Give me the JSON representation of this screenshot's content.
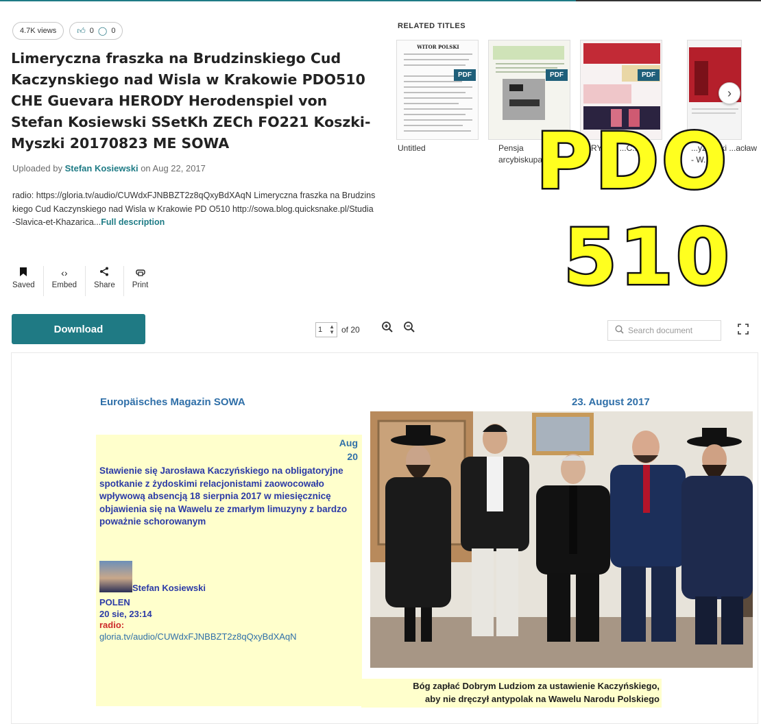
{
  "stats": {
    "views": "4.7K views",
    "likes": "0",
    "comments": "0"
  },
  "title": "Limeryczna fraszka na Brudzinskiego Cud Kaczynskiego nad Wisla w Krakowie PDO510 CHE Guevara HERODY Herodenspiel von Stefan Kosiewski SSetKh ZECh FO221 Koszki-Myszki 20170823 ME SOWA",
  "upload": {
    "prefix": "Uploaded by",
    "author": "Stefan Kosiewski",
    "date_text": "on Aug 22, 2017"
  },
  "description": {
    "text": "radio: https://gloria.tv/audio/CUWdxFJNBBZT2z8qQxyBdXAqN Limeryczna fraszka na Brudzinskiego Cud Kaczynskiego nad Wisla w Krakowie PD O510 http://sowa.blog.quicksnake.pl/Studia-Slavica-et-Khazarica...",
    "more_link": "Full description"
  },
  "actions": [
    {
      "label": "Saved",
      "icon": "bookmark-icon"
    },
    {
      "label": "Embed",
      "icon": "code-icon"
    },
    {
      "label": "Share",
      "icon": "share-icon"
    },
    {
      "label": "Print",
      "icon": "print-icon"
    }
  ],
  "download_label": "Download",
  "viewer": {
    "page": "1",
    "of_pages": "of 20",
    "search_placeholder": "Search document"
  },
  "related": {
    "heading": "RELATED TITLES",
    "pdf_badge": "PDF",
    "items": [
      {
        "label": "Untitled"
      },
      {
        "label": "Pensja arcybiskupa"
      },
      {
        "label": "...RYSTA ...C...SKI"
      },
      {
        "label": "...yżewski ...acław - W..."
      }
    ]
  },
  "overlay": {
    "line1": "PDO",
    "line2": "510"
  },
  "document": {
    "magazine": "Europäisches Magazin SOWA",
    "date": "23. August 2017",
    "post_month": "Aug",
    "post_day": "20",
    "post_text": "Stawienie się Jarosława Kaczyńskiego na obligatoryjne spotkanie z żydoskimi relacjonistami zaowocowało wpływową absencją 18 sierpnia 2017 w miesięcznicę objawienia się na Wawelu ze zmarłym limuzyny z bardzo poważnie schorowanym",
    "author": "Stefan Kosiewski",
    "country": "POLEN",
    "post_time": "20 sie, 23:14",
    "radio_label": "radio:",
    "radio_url": "gloria.tv/audio/CUWdxFJNBBZT2z8qQxyBdXAqN",
    "caption_line1": "Bóg zapłać Dobrym Ludziom za ustawienie Kaczyńskiego,",
    "caption_line2": "aby nie dręczył antypolak na Wawelu Narodu Polskiego"
  }
}
